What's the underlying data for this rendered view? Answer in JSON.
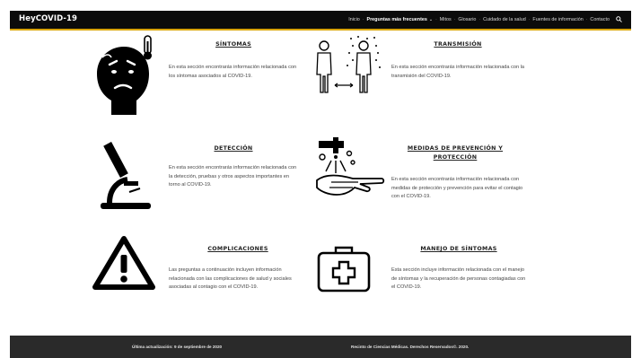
{
  "nav": {
    "brand": "HeyCOVID-19",
    "items": [
      {
        "label": "Inicio",
        "active": false
      },
      {
        "label": "Preguntas más frecuentes",
        "active": true
      },
      {
        "label": "Mitos",
        "active": false
      },
      {
        "label": "Glosario",
        "active": false
      },
      {
        "label": "Cuidado de la salud",
        "active": false
      },
      {
        "label": "Fuentes de información",
        "active": false
      },
      {
        "label": "Contacto",
        "active": false
      }
    ],
    "accent_color": "#d9a400"
  },
  "sections": [
    {
      "title": "SÍNTOMAS",
      "desc": "En esta sección encontrarás información relacionada con los síntomas asociados al COVID-19.",
      "icon": "sick-face-thermometer-icon"
    },
    {
      "title": "TRANSMISIÓN",
      "desc": "En esta sección encontrarás información relacionada con la transmisión del COVID-19.",
      "icon": "transmission-people-icon"
    },
    {
      "title": "DETECCIÓN",
      "desc": "En esta sección encontrarás información relacionada con la detección, pruebas y otros aspectos importantes en torno al COVID-19.",
      "icon": "microscope-icon"
    },
    {
      "title": "MEDIDAS DE PREVENCIÓN Y PROTECCIÓN",
      "desc": "En esta sección encontrarás información relacionada con medidas de protección y prevención para evitar el contagio con el COVID-19.",
      "icon": "hand-washing-icon"
    },
    {
      "title": "COMPLICACIONES",
      "desc": "Las preguntas a continuación incluyen información relacionada con las complicaciones de salud y sociales asociadas al contagio con el COVID-19.",
      "icon": "warning-triangle-icon"
    },
    {
      "title": "MANEJO DE SÍNTOMAS",
      "desc": "Esta sección incluye información relacionada con el manejo de síntomas y la recuperación de personas contagiadas con el COVID-19.",
      "icon": "first-aid-kit-icon"
    }
  ],
  "footer": {
    "updated": "Última actualización: 9 de septiembre de 2020",
    "rights": "Recinto de Ciencias Médicas. Derechos Reservados©. 2020."
  }
}
